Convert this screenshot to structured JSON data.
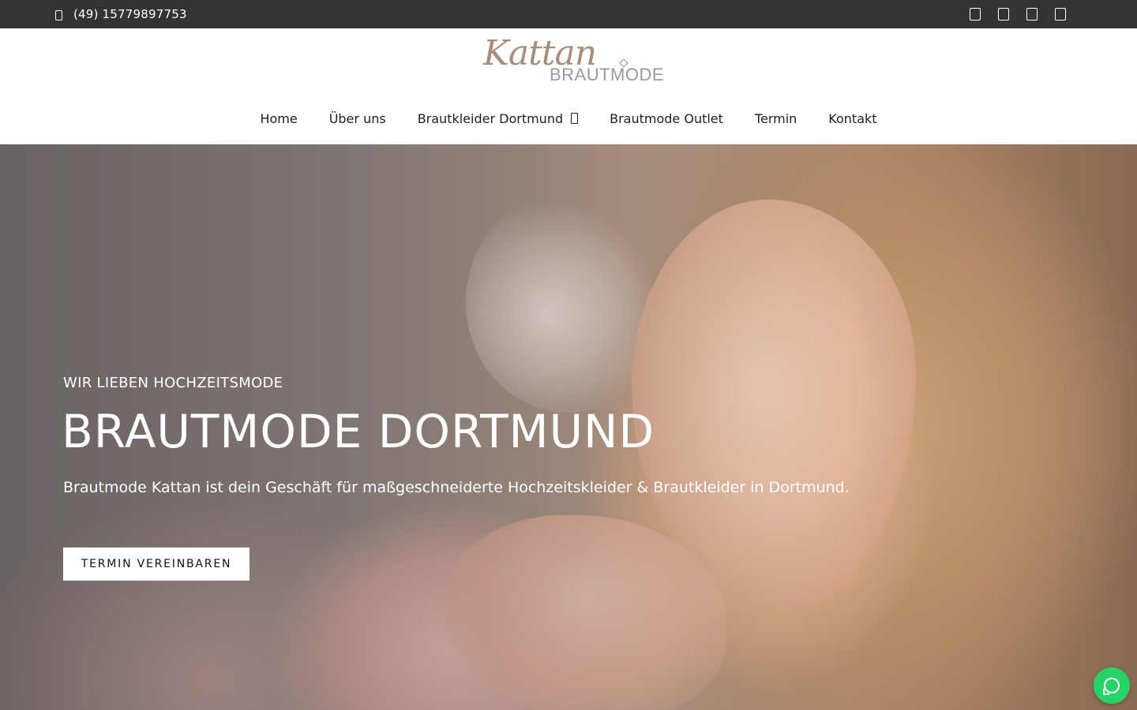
{
  "topbar": {
    "phone": "(49) 15779897753",
    "phone_icon": "phone-icon",
    "social_icons": [
      "facebook-icon",
      "instagram-icon",
      "youtube-icon",
      "tiktok-icon"
    ]
  },
  "logo": {
    "script": "Kattan",
    "brand": "BRAUTMODE"
  },
  "nav": {
    "items": [
      {
        "label": "Home"
      },
      {
        "label": "Über uns"
      },
      {
        "label": "Brautkleider Dortmund",
        "has_dropdown": true
      },
      {
        "label": "Brautmode Outlet"
      },
      {
        "label": "Termin"
      },
      {
        "label": "Kontakt"
      }
    ]
  },
  "hero": {
    "kicker": "WIR LIEBEN HOCHZEITSMODE",
    "title": "BRAUTMODE DORTMUND",
    "description": "Brautmode Kattan ist dein Geschäft für maßgeschneiderte Hochzeitskleider & Brautkleider in Dortmund.",
    "cta_label": "TERMIN VEREINBAREN"
  },
  "whatsapp": {
    "icon": "whatsapp-icon",
    "color": "#25d366"
  },
  "colors": {
    "topbar_bg": "#333333",
    "logo_accent": "#a88d7c"
  }
}
